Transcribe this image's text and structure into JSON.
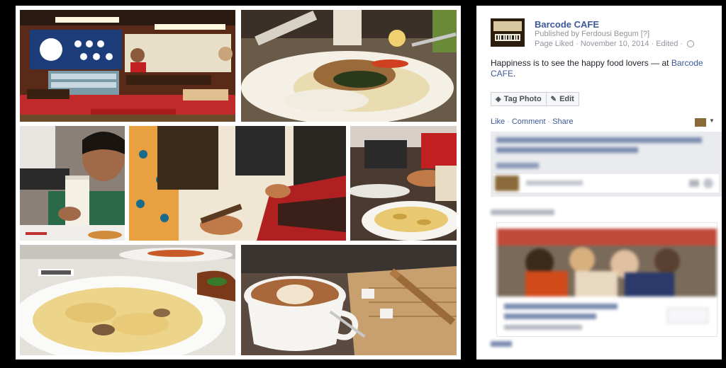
{
  "photo": {
    "tiles": [
      {
        "name": "photo-tile-cafe-interior"
      },
      {
        "name": "photo-tile-grilled-chicken"
      },
      {
        "name": "photo-tile-boy-milkshake"
      },
      {
        "name": "photo-tile-hands-table"
      },
      {
        "name": "photo-tile-pasta-diner"
      },
      {
        "name": "photo-tile-pasta-plate"
      },
      {
        "name": "photo-tile-cappuccino"
      }
    ]
  },
  "post": {
    "page_name": "Barcode CAFE",
    "published_by": "Published by Ferdousi Begum [?]",
    "meta_line": "Page Liked · November 10, 2014 · Edited ·",
    "caption_text": "Happiness is to see the happy food lovers",
    "caption_at": " — at",
    "caption_place": "Barcode CAFE",
    "caption_end": "."
  },
  "toolbar": {
    "tag_label": "Tag Photo",
    "edit_label": "Edit"
  },
  "actions": {
    "like": "Like",
    "comment": "Comment",
    "share": "Share"
  },
  "icons": {
    "tag": "tag-icon",
    "edit": "pencil-icon",
    "globe": "globe-icon",
    "dropdown": "caret-down-icon"
  },
  "colors": {
    "link": "#3b5998",
    "muted": "#90949c",
    "backdrop": "#000000"
  }
}
